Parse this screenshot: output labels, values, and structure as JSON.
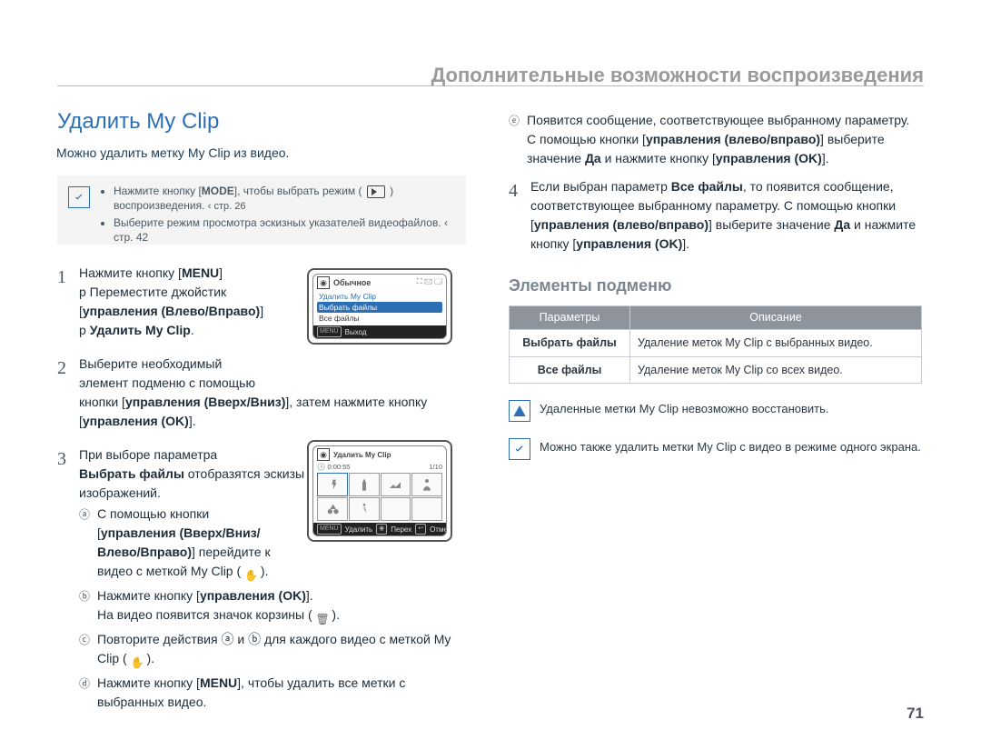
{
  "header": "Дополнительные возможности воспроизведения",
  "h1": "Удалить My Clip",
  "intro": "Можно удалить метку My Clip из видео.",
  "note": {
    "bullets": [
      "Нажмите кнопку [MODE], чтобы выбрать режим (   ) воспроизведения. ‹ стр. 26",
      "Выберите режим просмотра эскизных указателей видеофайлов. ‹ стр. 42"
    ]
  },
  "steps": {
    "s1": {
      "num": "1",
      "text": "Нажмите кнопку [MENU] p Переместите джойстик [управления (Влево/Вправо)] p Удалить My Clip."
    },
    "s2": {
      "num": "2",
      "text": "Выберите необходимый элемент подменю с помощью кнопки [управления (Вверх/Вниз)], затем нажмите кнопку [управления (OK)]."
    },
    "s3": {
      "num": "3",
      "text": "При выборе параметра Выбрать файлы отобразятся эскизы изображений.",
      "subs": [
        {
          "m": "ⓐ",
          "t": "С помощью кнопки [управления (Вверх/Вниз/Влево/Вправо)] перейдите к видео с меткой My Clip (    )."
        },
        {
          "m": "ⓑ",
          "t": "Нажмите кнопку [управления (OK)]. На видео появится значок корзины (    )."
        },
        {
          "m": "ⓒ",
          "t": "Повторите действия ⓐ и ⓑ для каждого видео с меткой My Clip (    )."
        },
        {
          "m": "ⓓ",
          "t": "Нажмите кнопку [MENU], чтобы удалить все метки с выбранных видео."
        }
      ]
    },
    "s3e": {
      "m": "ⓔ",
      "t": "Появится сообщение, соответствующее выбранному параметру. С помощью кнопки [управления (влево/вправо)] выберите значение Да и нажмите кнопку [управления (OK)]."
    },
    "s4": {
      "num": "4",
      "text": "Если выбран параметр Все файлы, то появится сообщение, соответствующее выбранному параметру. С помощью кнопки [управления (влево/вправо)] выберите значение Да и нажмите кнопку [управления (OK)]."
    }
  },
  "lcd1": {
    "title": "Обычное",
    "items": [
      "Удалить My Clip",
      "Выбрать файлы",
      "Все файлы"
    ],
    "exit": "Выход"
  },
  "lcd2": {
    "title": "Удалить My Clip",
    "time": "0:00:55",
    "count": "1/10",
    "bottom": [
      "Удалить",
      "Перех",
      "Отмена"
    ]
  },
  "h2": "Элементы подменю",
  "table": {
    "headers": [
      "Параметры",
      "Описание"
    ],
    "rows": [
      [
        "Выбрать файлы",
        "Удаление меток My Clip с выбранных видео."
      ],
      [
        "Все файлы",
        "Удаление меток My Clip со всех видео."
      ]
    ]
  },
  "warn1": "Удаленные метки My Clip невозможно восстановить.",
  "warn2": "Можно также удалить метки My Clip с видео в режиме одного экрана.",
  "page_num": "71"
}
